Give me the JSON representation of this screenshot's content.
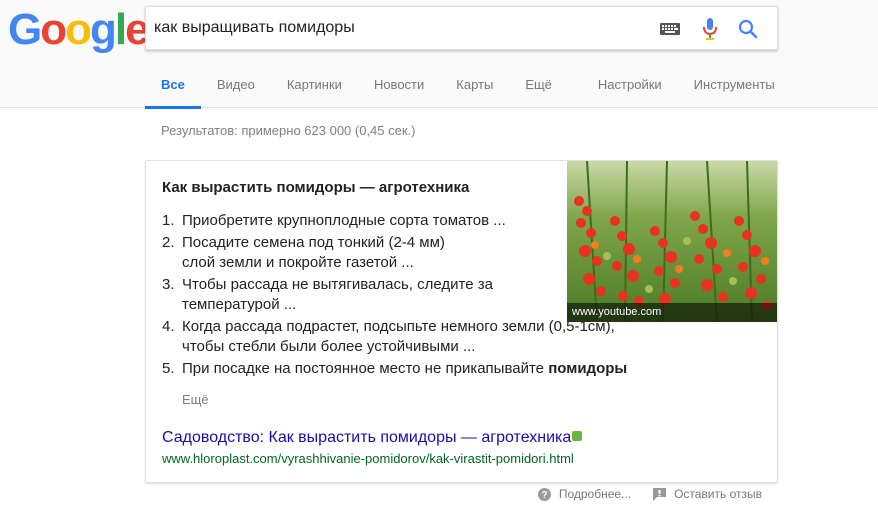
{
  "logo": {
    "letters": [
      "G",
      "o",
      "o",
      "g",
      "l",
      "e"
    ],
    "colors": [
      "#4285F4",
      "#EA4335",
      "#FBBC05",
      "#4285F4",
      "#34A853",
      "#EA4335"
    ]
  },
  "search": {
    "query": "как выращивать помидоры"
  },
  "tabs": [
    {
      "label": "Все",
      "active": true
    },
    {
      "label": "Видео"
    },
    {
      "label": "Картинки"
    },
    {
      "label": "Новости"
    },
    {
      "label": "Карты"
    },
    {
      "label": "Ещё"
    },
    {
      "label": "Настройки"
    },
    {
      "label": "Инструменты"
    }
  ],
  "results_count": "Результатов: примерно 623 000 (0,45 сек.)",
  "snippet": {
    "title": "Как вырастить помидоры — агротехника",
    "steps": [
      {
        "num": "1.",
        "text": "Приобретите крупноплодные сорта томатов ..."
      },
      {
        "num": "2.",
        "text": "Посадите семена под тонкий (2-4 мм) слой земли и покройте газетой ..."
      },
      {
        "num": "3.",
        "text": "Чтобы рассада не вытягивалась, следите за температурой ..."
      },
      {
        "num": "4.",
        "text": "Когда рассада подрастет, подсыпьте немного земли (0,5-1см), чтобы стебли были более устойчивыми ..."
      },
      {
        "num": "5.",
        "text": "При посадке на постоянное место не прикапывайте ",
        "bold": "помидоры"
      }
    ],
    "more": "Ещё",
    "image_caption": "www.youtube.com",
    "link_title": "Садоводство: Как вырастить помидоры — агротехника",
    "url": "www.hloroplast.com/vyrashhivanie-pomidorov/kak-virastit-pomidori.html"
  },
  "footer": {
    "more_info": "Подробнее...",
    "feedback": "Оставить отзыв"
  },
  "colors": {
    "accent": "#1a73e8",
    "link": "#1a0dab",
    "url": "#006621",
    "amp": "#6cb33f"
  }
}
